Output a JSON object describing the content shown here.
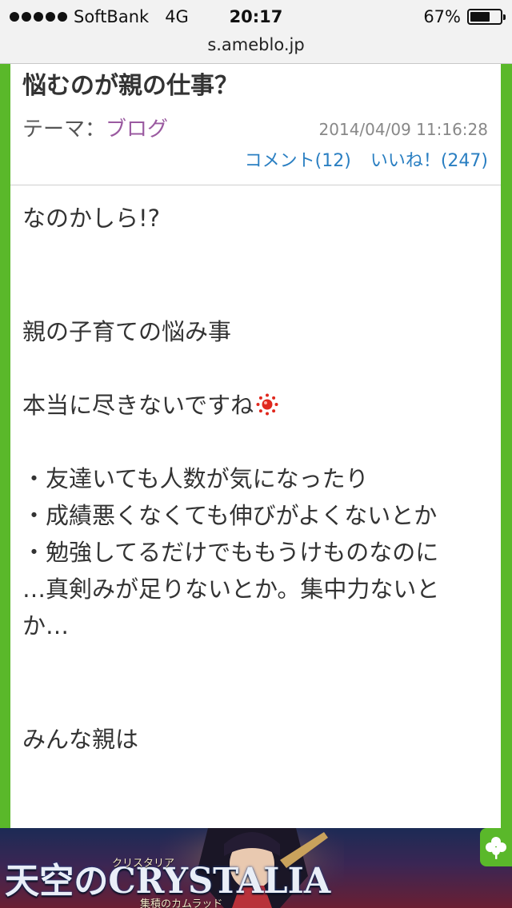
{
  "status_bar": {
    "carrier": "SoftBank",
    "network": "4G",
    "time": "20:17",
    "battery": "67%",
    "battery_level": 0.67
  },
  "browser": {
    "url": "s.ameblo.jp"
  },
  "article": {
    "title": "悩むのが親の仕事？",
    "theme_label": "テーマ：",
    "theme_value": "ブログ",
    "date": "2014/04/09 11:16:28",
    "comment_link": "コメント(12)",
    "like_link": "いいね！(247)",
    "body": {
      "line1": "なのかしら!?",
      "line2": "親の子育ての悩み事",
      "line3": "本当に尽きないですね",
      "line4": "・友達いても人数が気になったり",
      "line5": "・成績悪くなくても伸びがよくないとか",
      "line6": "・勉強してるだけでももうけものなのに",
      "line7": "…真剣みが足りないとか。集中力ないと",
      "line8": "か…",
      "line9": "みんな親は"
    }
  },
  "ad": {
    "logo_text": "天空のCRYSTALIA",
    "logo_ruby": "クリスタリア",
    "logo_subtitle": "集積のカムラッド"
  },
  "colors": {
    "frame_green": "#5ab82a",
    "theme_purple": "#9a5aa0",
    "link_blue": "#2a7fc2"
  }
}
